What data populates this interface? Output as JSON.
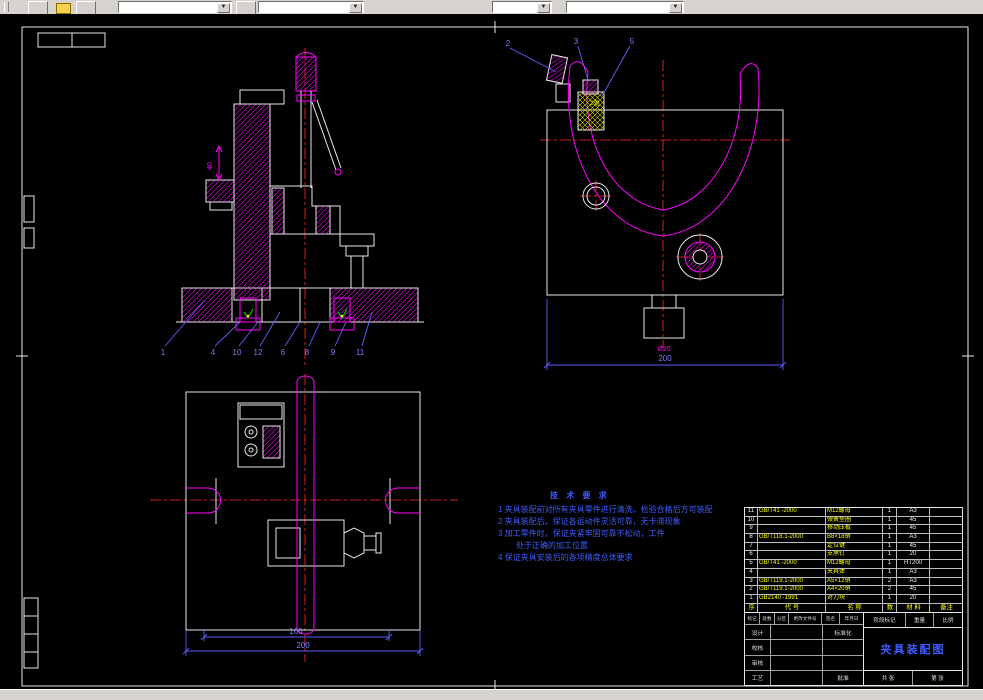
{
  "colors": {
    "canvas": "#000000",
    "chrome": "#d6d3ce",
    "white_line": "#e8e8e8",
    "magenta": "#ff00ff",
    "centerline_red": "#ff2a2a",
    "dimension_blue": "#5d5dff",
    "note_blue": "#3c5cff",
    "table_yellow": "#ffff00",
    "mark_green": "#00c000"
  },
  "toolbar": {
    "combos": [
      "",
      "",
      "",
      ""
    ]
  },
  "dimensions": {
    "side_view_width": "200",
    "top_view_inner": "160",
    "top_view_width": "200",
    "clamp_height": "40",
    "boss_label": "Ø20"
  },
  "balloons": {
    "front_view": [
      "1",
      "4",
      "10",
      "12",
      "6",
      "8",
      "9",
      "11"
    ],
    "side_view": [
      "2",
      "3",
      "5"
    ]
  },
  "annotations": {
    "side_view_note": "2处"
  },
  "notes": {
    "title": "技 术 要 求",
    "lines": [
      "1  夹具装配前对所有夹具零件进行清洗，检验合格后方可装配",
      "2  夹具装配后，保证各运动件灵活可靠，无卡滞现象",
      "3  加工零件时，保证夹紧牢固可靠不松动，工件",
      "处于正确的加工位置",
      "4  保证夹具安装后的各项精度总体要求"
    ]
  },
  "parts_table": {
    "header": {
      "no": "序",
      "code": "代  号",
      "name": "名  称",
      "qty": "数",
      "material": "材 料",
      "note": "备注"
    },
    "rows": [
      {
        "no": "11",
        "code": "GB/T41 -2000",
        "name": "M12螺母",
        "qty": "1",
        "material": "A3",
        "note": ""
      },
      {
        "no": "10",
        "code": "",
        "name": "弹簧垫圈",
        "qty": "1",
        "material": "45",
        "note": ""
      },
      {
        "no": "9",
        "code": "",
        "name": "移动压板",
        "qty": "1",
        "material": "45",
        "note": ""
      },
      {
        "no": "8",
        "code": "GB/T118.1-2000",
        "name": "B8×18销",
        "qty": "1",
        "material": "A3",
        "note": ""
      },
      {
        "no": "7",
        "code": "",
        "name": "定位键",
        "qty": "1",
        "material": "45",
        "note": ""
      },
      {
        "no": "6",
        "code": "",
        "name": "支承钉",
        "qty": "1",
        "material": "20",
        "note": ""
      },
      {
        "no": "5",
        "code": "GB/T41 -2000",
        "name": "M12螺母",
        "qty": "1",
        "material": "HT200",
        "note": ""
      },
      {
        "no": "4",
        "code": "",
        "name": "夹具体",
        "qty": "1",
        "material": "A3",
        "note": ""
      },
      {
        "no": "3",
        "code": "GB/T119.1-2000",
        "name": "A5×12销",
        "qty": "2",
        "material": "A3",
        "note": ""
      },
      {
        "no": "2",
        "code": "GB/T119.1-2000",
        "name": "A4×20销",
        "qty": "2",
        "material": "45",
        "note": ""
      },
      {
        "no": "1",
        "code": "GB2140 -1991",
        "name": "对刀块",
        "qty": "1",
        "material": "20",
        "note": ""
      }
    ]
  },
  "title_block": {
    "title": "夹具装配图",
    "row1": [
      "标记",
      "处数",
      "分区",
      "更改文件号",
      "签名",
      "年月日"
    ],
    "left": [
      [
        "设计",
        "标准化"
      ],
      [
        "校核",
        ""
      ],
      [
        "审核",
        ""
      ],
      [
        "工艺",
        "批准"
      ]
    ],
    "right_top": [
      "阶段标记",
      "重量",
      "比例"
    ],
    "sheet": [
      "共 张",
      "第 张"
    ]
  }
}
